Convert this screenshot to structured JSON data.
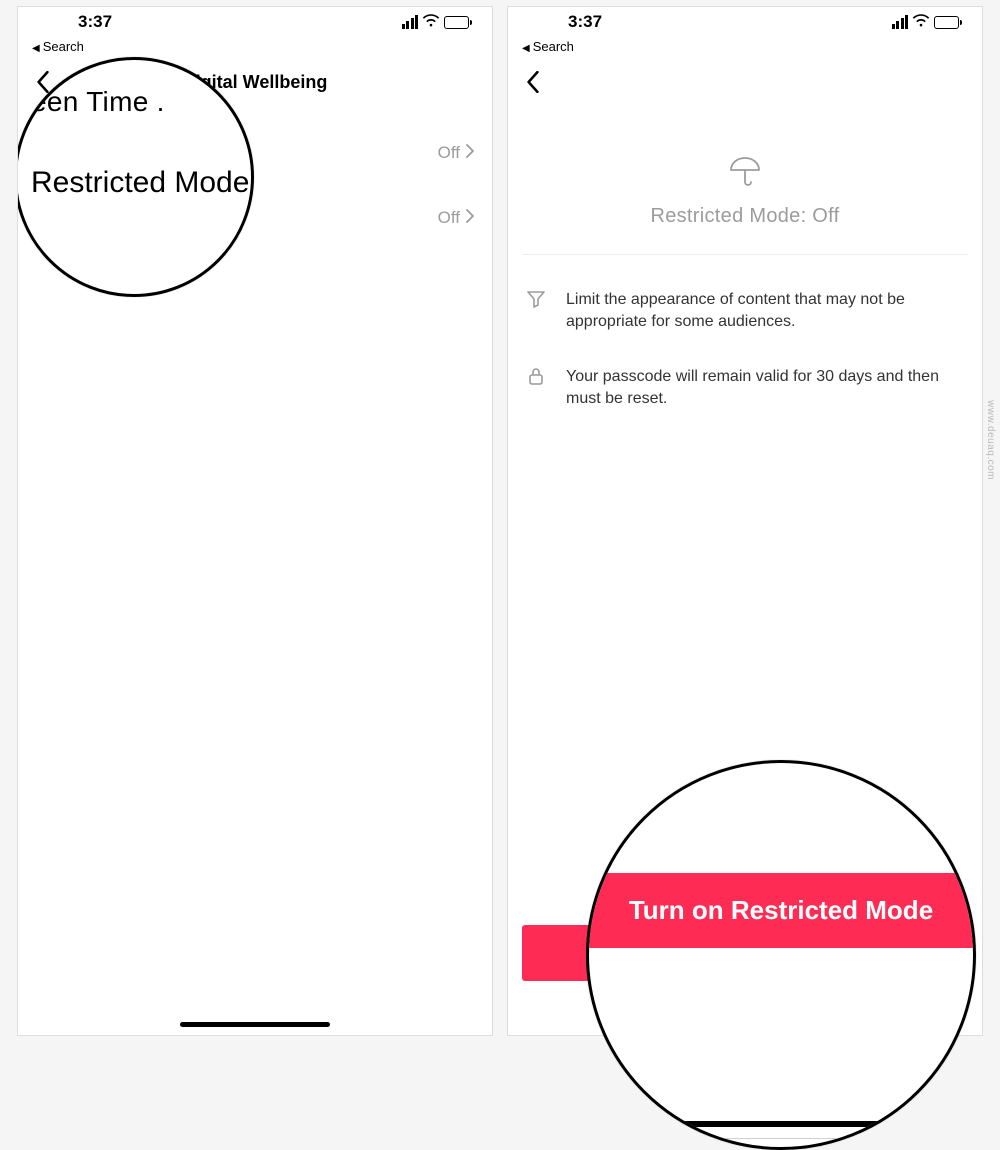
{
  "status": {
    "time": "3:37",
    "back_label": "Search"
  },
  "screen1": {
    "title": "Digital Wellbeing",
    "row1": {
      "label": "Screen Time Management",
      "value": "Off"
    },
    "row2": {
      "label": "Restricted Mode",
      "value": "Off"
    },
    "magnifier": {
      "line1": "een Time .",
      "line2": "Restricted Mode"
    }
  },
  "screen2": {
    "hero_title": "Restricted Mode: Off",
    "info1": "Limit the appearance of content that may not be appropriate for some audiences.",
    "info2": "Your passcode will remain valid for 30 days and then must be reset.",
    "button_label": "Turn on Restricted Mode",
    "magnifier_button": "Turn on Restricted Mode"
  },
  "colors": {
    "accent": "#fe2c55",
    "muted": "#9c9c9c"
  },
  "watermark": "www.deuaq.com"
}
